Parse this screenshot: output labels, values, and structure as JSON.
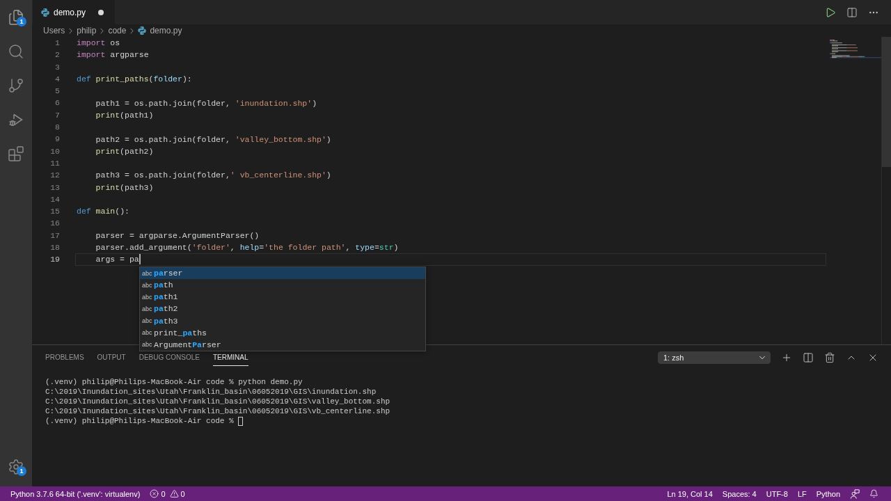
{
  "editor_tab": {
    "label": "demo.py",
    "modified": true
  },
  "breadcrumb": [
    "Users",
    "philip",
    "code",
    "demo.py"
  ],
  "activity_bar": {
    "explorer_badge": "1",
    "settings_badge": "1"
  },
  "code": {
    "lines": [
      {
        "number": "1",
        "current": false,
        "tokens": [
          {
            "kind": "control",
            "text": "import"
          },
          {
            "kind": "plain",
            "text": " os"
          }
        ]
      },
      {
        "number": "2",
        "current": false,
        "tokens": [
          {
            "kind": "control",
            "text": "import"
          },
          {
            "kind": "plain",
            "text": " argparse"
          }
        ]
      },
      {
        "number": "3",
        "current": false
      },
      {
        "number": "4",
        "current": false,
        "tokens": [
          {
            "kind": "keyword",
            "text": "def"
          },
          {
            "kind": "function",
            "text": " print_paths"
          },
          {
            "kind": "plain",
            "text": "("
          },
          {
            "kind": "parameter",
            "text": "folder"
          },
          {
            "kind": "plain",
            "text": "):"
          }
        ],
        "children": [
          {
            "number": "5",
            "current": false
          },
          {
            "number": "6",
            "current": false,
            "tokens": [
              {
                "kind": "plain",
                "text": "path1 = os.path.join(folder, "
              },
              {
                "kind": "string",
                "text": "'inundation.shp'"
              },
              {
                "kind": "plain",
                "text": ")"
              }
            ]
          },
          {
            "number": "7",
            "current": false,
            "tokens": [
              {
                "kind": "function",
                "text": "print"
              },
              {
                "kind": "plain",
                "text": "(path1)"
              }
            ]
          },
          {
            "number": "8",
            "current": false
          },
          {
            "number": "9",
            "current": false,
            "tokens": [
              {
                "kind": "plain",
                "text": "path2 = os.path.join(folder, "
              },
              {
                "kind": "string",
                "text": "'valley_bottom.shp'"
              },
              {
                "kind": "plain",
                "text": ")"
              }
            ]
          },
          {
            "number": "10",
            "current": false,
            "tokens": [
              {
                "kind": "function",
                "text": "print"
              },
              {
                "kind": "plain",
                "text": "(path2)"
              }
            ]
          },
          {
            "number": "11",
            "current": false
          },
          {
            "number": "12",
            "current": false,
            "tokens": [
              {
                "kind": "plain",
                "text": "path3 = os.path.join(folder,"
              },
              {
                "kind": "string",
                "text": "' vb_centerline.shp'"
              },
              {
                "kind": "plain",
                "text": ")"
              }
            ]
          },
          {
            "number": "13",
            "current": false,
            "tokens": [
              {
                "kind": "function",
                "text": "print"
              },
              {
                "kind": "plain",
                "text": "(path3)"
              }
            ]
          }
        ]
      },
      {
        "number": "14",
        "current": false
      },
      {
        "number": "15",
        "current": false,
        "tokens": [
          {
            "kind": "keyword",
            "text": "def"
          },
          {
            "kind": "function",
            "text": " main"
          },
          {
            "kind": "plain",
            "text": "():"
          }
        ],
        "children": [
          {
            "number": "16",
            "current": false
          },
          {
            "number": "17",
            "current": false,
            "tokens": [
              {
                "kind": "plain",
                "text": "parser = argparse.ArgumentParser()"
              }
            ]
          },
          {
            "number": "18",
            "current": false,
            "tokens": [
              {
                "kind": "plain",
                "text": "parser.add_argument("
              },
              {
                "kind": "string",
                "text": "'folder'"
              },
              {
                "kind": "plain",
                "text": ", "
              },
              {
                "kind": "parameter",
                "text": "help"
              },
              {
                "kind": "plain",
                "text": "="
              },
              {
                "kind": "string",
                "text": "'the folder path'"
              },
              {
                "kind": "plain",
                "text": ", "
              },
              {
                "kind": "parameter",
                "text": "type"
              },
              {
                "kind": "plain",
                "text": "="
              },
              {
                "kind": "type",
                "text": "str"
              },
              {
                "kind": "plain",
                "text": ")"
              }
            ]
          },
          {
            "number": "19",
            "current": true,
            "tokens": [
              {
                "kind": "plain",
                "text": "args = pa"
              }
            ]
          }
        ]
      }
    ]
  },
  "suggestions": [
    {
      "icon_text": "abc",
      "match": "pa",
      "after": "rser",
      "selected": true
    },
    {
      "icon_text": "abc",
      "match": "pa",
      "after": "th",
      "selected": false
    },
    {
      "icon_text": "abc",
      "match": "pa",
      "after": "th1",
      "selected": false
    },
    {
      "icon_text": "abc",
      "match": "pa",
      "after": "th2",
      "selected": false
    },
    {
      "icon_text": "abc",
      "match": "pa",
      "after": "th3",
      "selected": false
    },
    {
      "icon_text": "abc",
      "before": "print_",
      "match": "pa",
      "after": "ths",
      "selected": false
    },
    {
      "icon_text": "abc",
      "before": "Argument",
      "match": "Pa",
      "after": "rser",
      "selected": false
    }
  ],
  "panel": {
    "tabs": [
      {
        "label": "PROBLEMS",
        "selected": false
      },
      {
        "label": "OUTPUT",
        "selected": false
      },
      {
        "label": "DEBUG CONSOLE",
        "selected": false
      },
      {
        "label": "TERMINAL",
        "selected": true
      }
    ],
    "terminal_selector": "1: zsh",
    "terminal_lines": [
      "(.venv) philip@Philips-MacBook-Air code % python demo.py",
      "C:\\2019\\Inundation_sites\\Utah\\Franklin_basin\\06052019\\GIS\\inundation.shp",
      "C:\\2019\\Inundation_sites\\Utah\\Franklin_basin\\06052019\\GIS\\valley_bottom.shp",
      "C:\\2019\\Inundation_sites\\Utah\\Franklin_basin\\06052019\\GIS\\vb_centerline.shp",
      "(.venv) philip@Philips-MacBook-Air code %"
    ]
  },
  "status_bar": {
    "interpreter": "Python 3.7.6 64-bit ('.venv': virtualenv)",
    "errors": "0",
    "warnings": "0",
    "cursor_position": "Ln 19, Col 14",
    "indentation": "Spaces: 4",
    "encoding": "UTF-8",
    "line_ending": "LF",
    "language": "Python"
  }
}
